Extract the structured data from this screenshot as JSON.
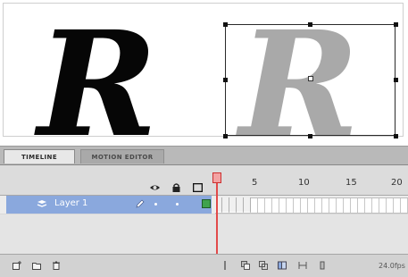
{
  "stage": {
    "glyph_left": "R",
    "glyph_right": "R",
    "colors": {
      "glyph_left": "#060606",
      "glyph_right": "#a9a9a9"
    }
  },
  "panel": {
    "tabs": [
      {
        "label": "TIMELINE",
        "active": true
      },
      {
        "label": "MOTION EDITOR",
        "active": false
      }
    ],
    "frame_ruler": [
      "5",
      "10",
      "15",
      "20"
    ],
    "layers": [
      {
        "name": "Layer 1",
        "selected": true,
        "color": "#3fa34d"
      }
    ],
    "fps_text": "24.0fps"
  },
  "icons": {
    "eye": "eye-icon",
    "lock": "lock-icon",
    "outline": "outline-icon",
    "layer": "layer-icon",
    "pencil": "pencil-icon"
  },
  "colors": {
    "selection_blue": "#8aa8dd",
    "playhead": "#e24a4a"
  }
}
